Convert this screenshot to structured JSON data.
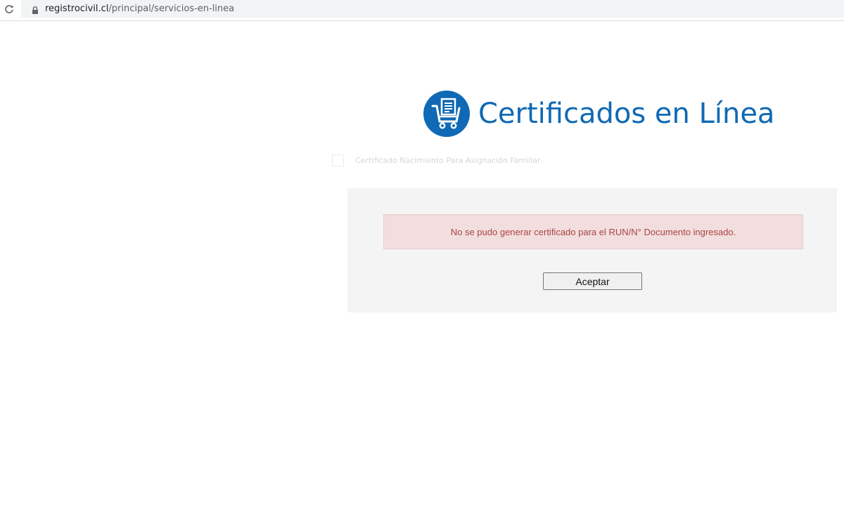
{
  "browser": {
    "url_domain": "registrocivil.cl",
    "url_path": "/principal/servicios-en-linea"
  },
  "header": {
    "title": "Certificados en Línea",
    "logo_icon": "shopping-cart-document-icon",
    "accent_color": "#0f69b4"
  },
  "certificate_option": {
    "label": "Certificado Nacimiento Para Asignación Familiar",
    "checked": false
  },
  "dialog": {
    "error_message": "No se pudo generar certificado para el RUN/N° Documento ingresado.",
    "accept_label": "Aceptar",
    "error_color": "#a94442",
    "error_bg": "#f2dede"
  }
}
